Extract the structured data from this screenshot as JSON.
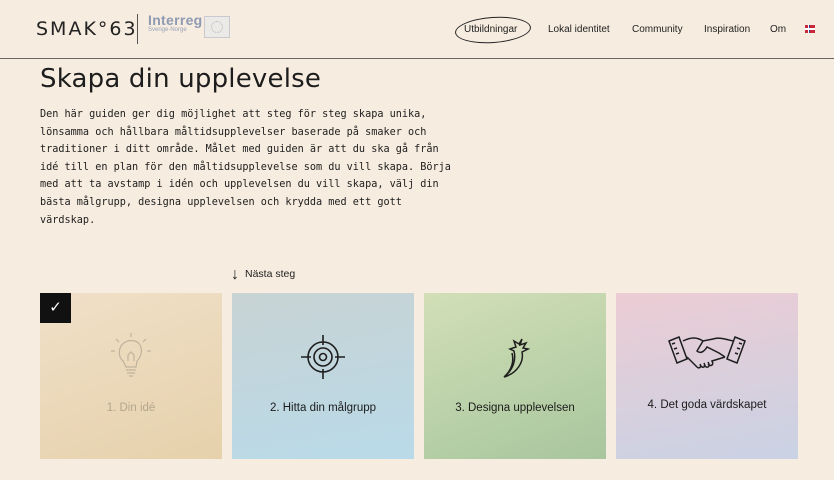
{
  "header": {
    "logo": "SMAK°63",
    "partner_title": "Interreg",
    "partner_sub": "Sverige-Norge",
    "nav": [
      {
        "label": "Utbildningar"
      },
      {
        "label": "Lokal identitet"
      },
      {
        "label": "Community"
      },
      {
        "label": "Inspiration"
      },
      {
        "label": "Om"
      }
    ],
    "language_flag": "norway-flag-icon"
  },
  "main": {
    "title": "Skapa din upplevelse",
    "intro": "Den här guiden ger dig möjlighet att steg för steg skapa unika,\nlönsamma och hållbara måltidsupplevelser baserade på smaker och\ntraditioner i ditt område. Målet med guiden är att du ska gå från\nidé till en plan för den måltidsupplevelse som du vill skapa. Börja\nmed att ta avstamp i idén och upplevelsen du vill skapa, välj din\nbästa målgrupp, designa upplevelsen och krydda med ett gott\nvärdskap.",
    "next_step": "Nästa steg",
    "steps": [
      {
        "label": "1. Din idé",
        "icon": "lightbulb-icon",
        "completed": true
      },
      {
        "label": "2. Hitta din målgrupp",
        "icon": "target-icon",
        "completed": false
      },
      {
        "label": "3. Designa upplevelsen",
        "icon": "chili-icon",
        "completed": false
      },
      {
        "label": "4. Det goda värdskapet",
        "icon": "handshake-icon",
        "completed": false
      }
    ]
  },
  "colors": {
    "background": "#f6ecdf",
    "step1": "#e9d6b4",
    "step2": "#c0d8e2",
    "step3": "#bcd3a9",
    "step4": "#dccdda"
  }
}
